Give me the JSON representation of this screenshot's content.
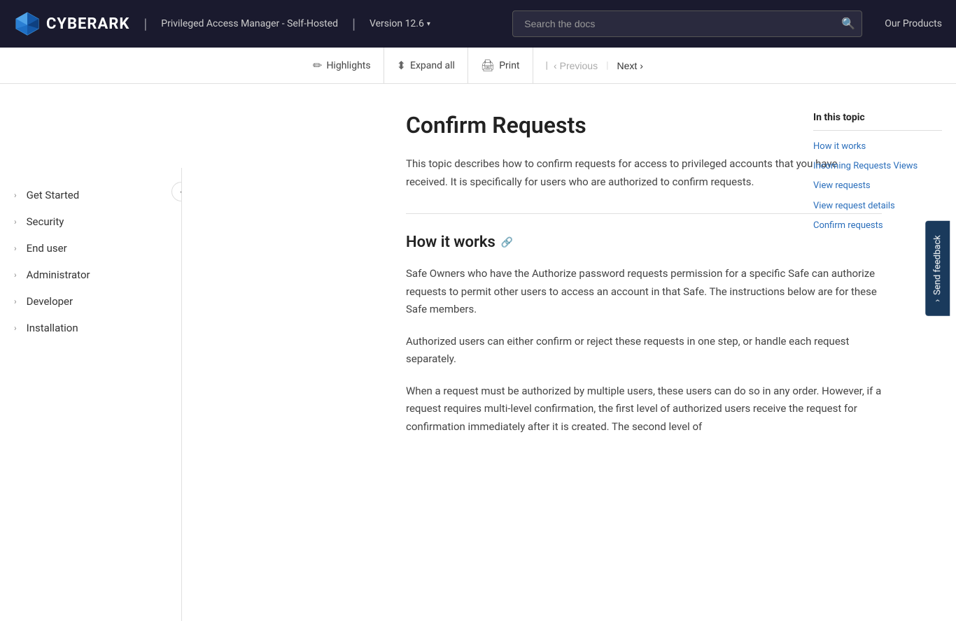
{
  "header": {
    "logo_text": "CYBERARK",
    "product_name": "Privileged Access Manager - Self-Hosted",
    "version": "Version 12.6",
    "search_placeholder": "Search the docs",
    "our_products_label": "Our Products"
  },
  "toolbar": {
    "highlights_label": "Highlights",
    "expand_all_label": "Expand all",
    "print_label": "Print",
    "previous_label": "Previous",
    "next_label": "Next"
  },
  "sidebar": {
    "items": [
      {
        "label": "Get Started"
      },
      {
        "label": "Security"
      },
      {
        "label": "End user"
      },
      {
        "label": "Administrator"
      },
      {
        "label": "Developer"
      },
      {
        "label": "Installation"
      }
    ]
  },
  "main": {
    "page_title": "Confirm Requests",
    "intro_text": "This topic describes how to confirm requests for access to privileged accounts that you have received. It is specifically for users who are authorized to confirm requests.",
    "section1_heading": "How it works",
    "section1_para1": "Safe Owners who have the Authorize password requests permission for a specific Safe can authorize requests to permit other users to access an account in that Safe. The instructions below are for these Safe members.",
    "section1_para2": "Authorized users can either confirm or reject these requests in one step, or handle each request separately.",
    "section1_para3": "When a request must be authorized by multiple users, these users can do so in any order. However, if a request requires multi-level confirmation, the first level of authorized users receive the request for confirmation immediately after it is created. The second level of"
  },
  "toc": {
    "title": "In this topic",
    "items": [
      {
        "label": "How it works"
      },
      {
        "label": "Incoming Requests Views"
      },
      {
        "label": "View requests"
      },
      {
        "label": "View request details"
      },
      {
        "label": "Confirm requests"
      }
    ]
  },
  "feedback": {
    "label": "Send feedback"
  },
  "icons": {
    "highlights": "✏",
    "expand_all": "⬍",
    "print": "🖨",
    "search": "🔍",
    "chevron_right": "›",
    "chevron_down": "⌄",
    "arrow_left": "‹",
    "arrow_right": "›",
    "anchor": "🔗",
    "collapse": "‹"
  }
}
